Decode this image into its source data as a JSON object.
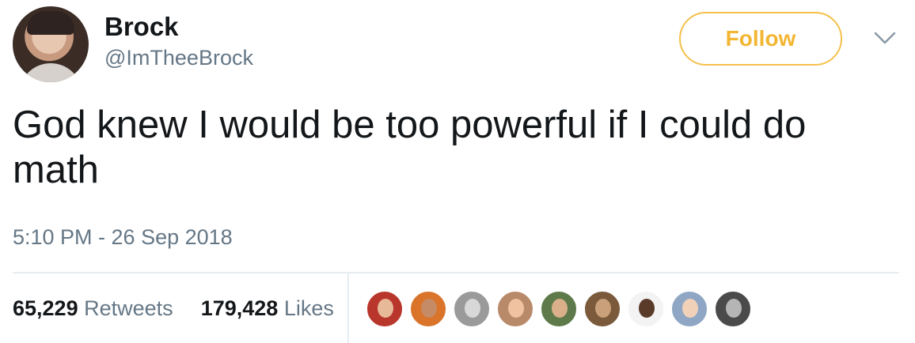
{
  "author": {
    "name": "Brock",
    "handle": "@ImTheeBrock"
  },
  "follow_label": "Follow",
  "tweet_text": "God knew I would be too powerful if I could do math",
  "timestamp": "5:10 PM - 26 Sep 2018",
  "stats": {
    "retweets_count": "65,229",
    "retweets_label": "Retweets",
    "likes_count": "179,428",
    "likes_label": "Likes"
  },
  "colors": {
    "follow_accent": "#f5c04a",
    "secondary_text": "#657786",
    "primary_text": "#14171a"
  },
  "likers": [
    {
      "avatar_bg": "#b8362c",
      "face": "#e8b998"
    },
    {
      "avatar_bg": "#d9742a",
      "face": "#c58a66"
    },
    {
      "avatar_bg": "#9a9a9a",
      "face": "#d8d8d8"
    },
    {
      "avatar_bg": "#b98a6a",
      "face": "#f0c2a0"
    },
    {
      "avatar_bg": "#5e7a4a",
      "face": "#d9b08a"
    },
    {
      "avatar_bg": "#7a5a3a",
      "face": "#caa07a"
    },
    {
      "avatar_bg": "#f3f3f3",
      "face": "#5a3a28"
    },
    {
      "avatar_bg": "#8fa7c4",
      "face": "#f1d2b8"
    },
    {
      "avatar_bg": "#4a4a4a",
      "face": "#b5b5b5"
    }
  ]
}
